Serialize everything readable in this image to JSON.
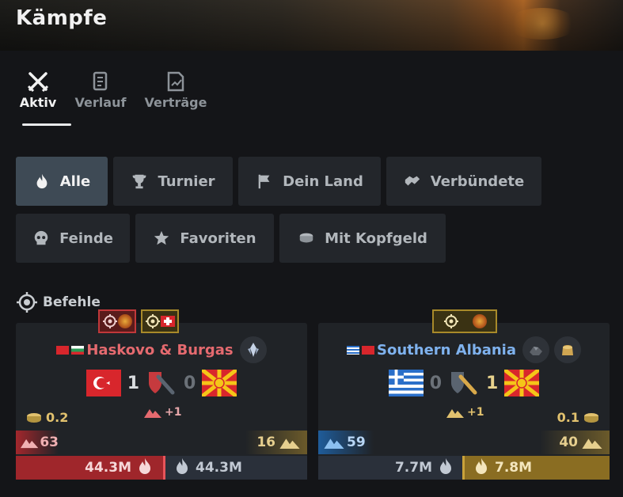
{
  "title": "Kämpfe",
  "tabs": [
    {
      "label": "Aktiv",
      "icon": "crossed-swords-icon",
      "active": true
    },
    {
      "label": "Verlauf",
      "icon": "scroll-icon",
      "active": false
    },
    {
      "label": "Verträge",
      "icon": "contract-icon",
      "active": false
    }
  ],
  "filters": [
    {
      "label": "Alle",
      "icon": "flame-icon",
      "active": true
    },
    {
      "label": "Turnier",
      "icon": "trophy-icon"
    },
    {
      "label": "Dein Land",
      "icon": "flag-icon"
    },
    {
      "label": "Verbündete",
      "icon": "handshake-icon"
    },
    {
      "label": "Feinde",
      "icon": "skull-icon"
    },
    {
      "label": "Favoriten",
      "icon": "star-icon"
    },
    {
      "label": "Mit Kopfgeld",
      "icon": "coins-icon"
    }
  ],
  "section_label": "Befehle",
  "battles": [
    {
      "region": "Haskovo & Burgas",
      "attacker_score": "1",
      "defender_score": "0",
      "attacker_rate": "0.2",
      "wall_bonus": "+1",
      "left_strip_value": "63",
      "right_strip_value": "16",
      "left_damage": "44.3M",
      "right_damage": "44.3M",
      "colors": {
        "left": "#b5262c",
        "right": "#2b3240"
      }
    },
    {
      "region": "Southern Albania",
      "attacker_score": "0",
      "defender_score": "1",
      "defender_rate": "0.1",
      "wall_bonus": "+1",
      "left_strip_value": "59",
      "right_strip_value": "40",
      "left_damage": "7.7M",
      "right_damage": "7.8M",
      "colors": {
        "left": "#2b3240",
        "right": "#a8852a"
      }
    }
  ]
}
